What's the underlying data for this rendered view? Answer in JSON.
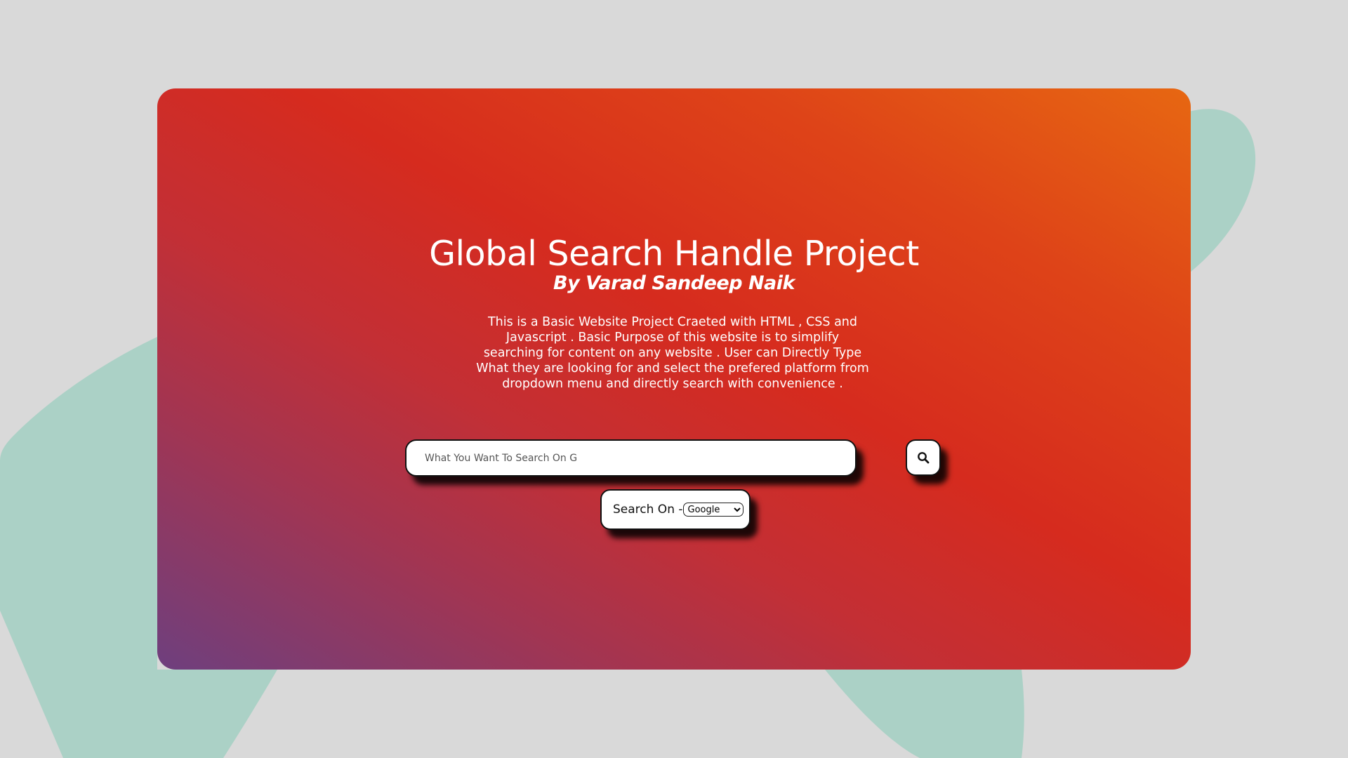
{
  "page": {
    "background_color": "#d9d9d9",
    "blob_color": "#abd1c6"
  },
  "card": {
    "gradient_colors": [
      "#6e3f7e",
      "#d62b1e",
      "#e76712"
    ]
  },
  "header": {
    "title": "Global Search Handle Project",
    "subtitle": "By Varad Sandeep Naik"
  },
  "description": "This is a Basic Website Project Craeted with HTML , CSS and Javascript . Basic Purpose of this website is to simplify searching for content on any website . User can Directly Type What they are looking for and select the prefered platform from dropdown menu and directly search with convenience .",
  "search": {
    "placeholder": "What You Want To Search On G",
    "value": "",
    "button_icon": "search-icon"
  },
  "engine": {
    "label": "Search On -",
    "selected": "Google"
  }
}
